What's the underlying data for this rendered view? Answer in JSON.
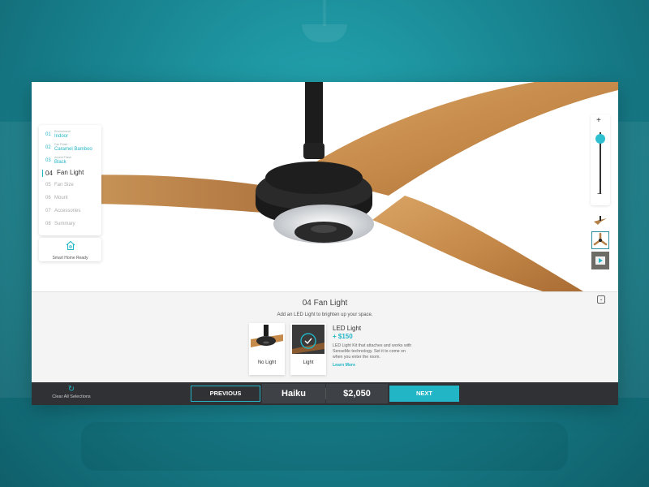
{
  "steps": [
    {
      "num": "01",
      "small": "Environment",
      "value": "Indoor",
      "state": "done"
    },
    {
      "num": "02",
      "small": "Fan Finish",
      "value": "Caramel Bamboo",
      "state": "done"
    },
    {
      "num": "03",
      "small": "Accent Finish",
      "value": "Black",
      "state": "done"
    },
    {
      "num": "04",
      "small": "",
      "value": "Fan Light",
      "state": "active"
    },
    {
      "num": "05",
      "small": "",
      "value": "Fan Size",
      "state": "pending"
    },
    {
      "num": "06",
      "small": "",
      "value": "Mount",
      "state": "pending"
    },
    {
      "num": "07",
      "small": "",
      "value": "Accessories",
      "state": "pending"
    },
    {
      "num": "08",
      "small": "",
      "value": "Summary",
      "state": "pending"
    }
  ],
  "smart_home": {
    "label": "Smart Home Ready",
    "icon": "house-icon"
  },
  "zoom": {
    "plus": "+",
    "minus": "−",
    "level": 0.9
  },
  "panel": {
    "title": "04 Fan Light",
    "subtitle": "Add an LED Light to brighten up your space.",
    "options": [
      {
        "label": "No Light",
        "selected": false
      },
      {
        "label": "Light",
        "selected": true
      }
    ],
    "info": {
      "title": "LED Light",
      "price": "+ $150",
      "description": "LED Light Kit that attaches and works with SenseMe technology. Set it to come on when you enter the room.",
      "link": "Learn More"
    }
  },
  "footer": {
    "clear_label": "Clear All Selections",
    "previous": "PREVIOUS",
    "model": "Haiku",
    "price": "$2,050",
    "next": "NEXT"
  },
  "colors": {
    "accent": "#22b5c6",
    "footer": "#2f3134",
    "bamboo": "#c98d4c"
  }
}
